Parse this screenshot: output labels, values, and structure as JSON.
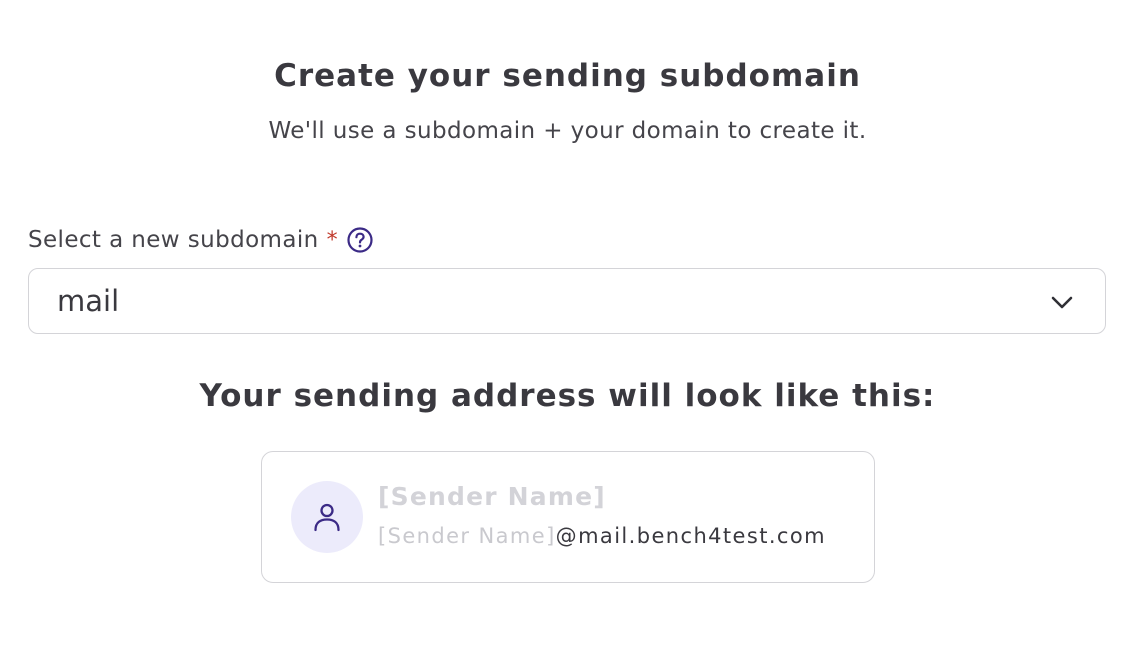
{
  "header": {
    "title": "Create your sending subdomain",
    "subtitle": "We'll use a subdomain + your domain to create it."
  },
  "subdomain_field": {
    "label": "Select a new subdomain",
    "required_marker": "*",
    "help_icon": "question-circle-icon",
    "selected_value": "mail",
    "dropdown_icon": "chevron-down-icon"
  },
  "preview": {
    "heading": "Your sending address will look like this:",
    "avatar_icon": "user-icon",
    "sender_name_placeholder": "[Sender Name]",
    "address_local_placeholder": "[Sender Name]",
    "address_domain": "@mail.bench4test.com"
  },
  "colors": {
    "accent": "#3b2a86",
    "avatar_bg": "#ecebfb",
    "required": "#c0392b",
    "placeholder": "#c9c9ce",
    "border": "#d4d4d8"
  }
}
